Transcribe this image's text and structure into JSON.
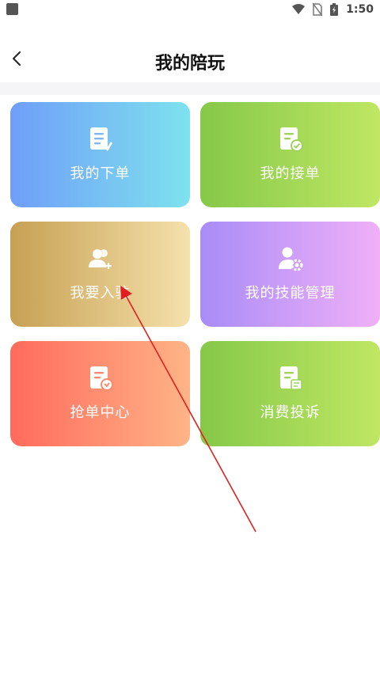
{
  "status_bar": {
    "time": "1:50"
  },
  "header": {
    "title": "我的陪玩"
  },
  "menu": [
    {
      "label": "我的下单",
      "icon": "order-doc-edit-icon",
      "gradient": [
        "#6f9ef8",
        "#7ee2ee"
      ]
    },
    {
      "label": "我的接单",
      "icon": "order-doc-check-icon",
      "gradient": [
        "#86c849",
        "#bfe763"
      ]
    },
    {
      "label": "我要入驻",
      "icon": "user-add-icon",
      "gradient": [
        "#c7a053",
        "#f5e1ac"
      ]
    },
    {
      "label": "我的技能管理",
      "icon": "user-gear-icon",
      "gradient": [
        "#a98cf7",
        "#f0b0f8"
      ]
    },
    {
      "label": "抢单中心",
      "icon": "order-doc-grab-icon",
      "gradient": [
        "#ff6a5c",
        "#ffb487"
      ]
    },
    {
      "label": "消费投诉",
      "icon": "complaint-doc-icon",
      "gradient": [
        "#86c849",
        "#bfe763"
      ]
    }
  ],
  "annotation": {
    "arrow_color": "#e02020"
  }
}
